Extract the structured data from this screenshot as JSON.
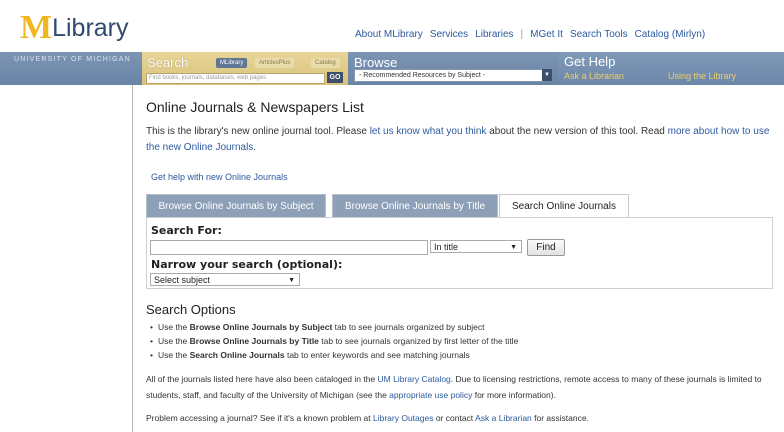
{
  "header": {
    "logo_m": "M",
    "logo_text": "Library",
    "nav": [
      "About MLibrary",
      "Services",
      "Libraries",
      "|",
      "MGet It",
      "Search Tools",
      "Catalog (Mirlyn)"
    ]
  },
  "bar": {
    "umich": "UNIVERSITY OF MICHIGAN",
    "search_title": "Search",
    "search_tabs": [
      "MLibrary",
      "ArticlesPlus",
      "Catalog"
    ],
    "search_placeholder": "Find books, journals, databases, web pages",
    "go_label": "GO",
    "browse_title": "Browse",
    "browse_select": "- Recommended Resources by Subject -",
    "gethelp_title": "Get Help",
    "gethelp_links": [
      "Ask a Librarian",
      "Using the Library"
    ]
  },
  "page": {
    "title": "Online Journals & Newspapers List",
    "intro_a": "This is the library's new online journal tool. Please ",
    "intro_link1": "let us know what you think",
    "intro_b": " about the new version of this tool. Read ",
    "intro_link2": "more about how to use the new Online Journals",
    "intro_c": ".",
    "help_link": "Get help with new Online Journals"
  },
  "tabs": [
    "Browse Online Journals by Subject",
    "Browse Online Journals by Title",
    "Search Online Journals"
  ],
  "search": {
    "label": "Search For:",
    "input_value": "",
    "scope_selected": "In title",
    "find_label": "Find",
    "narrow_label": "Narrow your search (optional):",
    "subject_selected": "Select subject"
  },
  "options": {
    "title": "Search Options",
    "items": [
      {
        "pre": "Use the ",
        "bold": "Browse Online Journals by Subject",
        "post": " tab to see journals organized by subject"
      },
      {
        "pre": "Use the ",
        "bold": "Browse Online Journals by Title",
        "post": " tab to see journals organized by first letter of the title"
      },
      {
        "pre": "Use the ",
        "bold": "Search Online Journals",
        "post": " tab to enter keywords and see matching journals"
      }
    ],
    "para1_a": "All of the journals listed here have also been cataloged in the ",
    "para1_link1": "UM Library Catalog",
    "para1_b": ". Due to licensing restrictions, remote access to many of these journals is limited to students, staff, and faculty of the University of Michigan (see the ",
    "para1_link2": "appropriate use policy",
    "para1_c": " for more information).",
    "para2_a": "Problem accessing a journal? See if it's a known problem at ",
    "para2_link1": "Library Outages",
    "para2_b": " or contact ",
    "para2_link2": "Ask a Librarian",
    "para2_c": " for assistance."
  }
}
